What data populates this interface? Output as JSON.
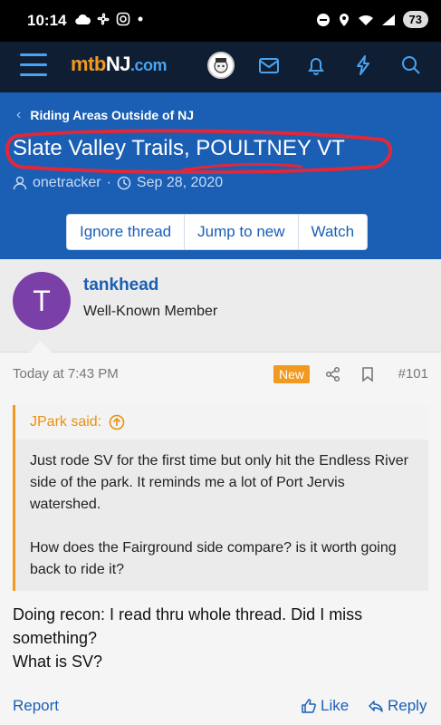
{
  "statusbar": {
    "time": "10:14",
    "battery": "73",
    "icons": [
      "cloud-icon",
      "fan-icon",
      "instagram-icon",
      "dot-icon",
      "dnd-icon",
      "location-icon",
      "wifi-icon",
      "signal-icon"
    ]
  },
  "navbar": {
    "logo_m": "mtb",
    "logo_nj": "NJ",
    "logo_dotcom": ".com",
    "icons": [
      "menu-icon",
      "avatar",
      "inbox-icon",
      "bell-icon",
      "bolt-icon",
      "search-icon"
    ]
  },
  "header": {
    "breadcrumb": "Riding Areas Outside of NJ",
    "title": "Slate Valley Trails, POULTNEY VT",
    "author": "onetracker",
    "separator": "·",
    "date": "Sep 28, 2020",
    "buttons": [
      "Ignore thread",
      "Jump to new",
      "Watch"
    ]
  },
  "user": {
    "initial": "T",
    "name": "tankhead",
    "title": "Well-Known Member",
    "avatar_color": "#7b3fa8"
  },
  "post": {
    "time": "Today at 7:43 PM",
    "badge": "New",
    "number": "#101",
    "quote_author": "JPark said:",
    "quote_p1": "Just rode SV for the first time but only hit the Endless River side of the park. It reminds me a lot of Port Jervis watershed.",
    "quote_p2": "How does the Fairground side compare? is it worth going back to ride it?",
    "body_line1": "Doing recon: I read thru whole thread. Did I miss something?",
    "body_line2": "What is SV?",
    "report": "Report",
    "like": "Like",
    "reply": "Reply"
  },
  "colors": {
    "accent": "#1a5fb4",
    "navbar": "#0f1e33",
    "orange": "#f29a1f",
    "annotation": "#e0283a"
  }
}
